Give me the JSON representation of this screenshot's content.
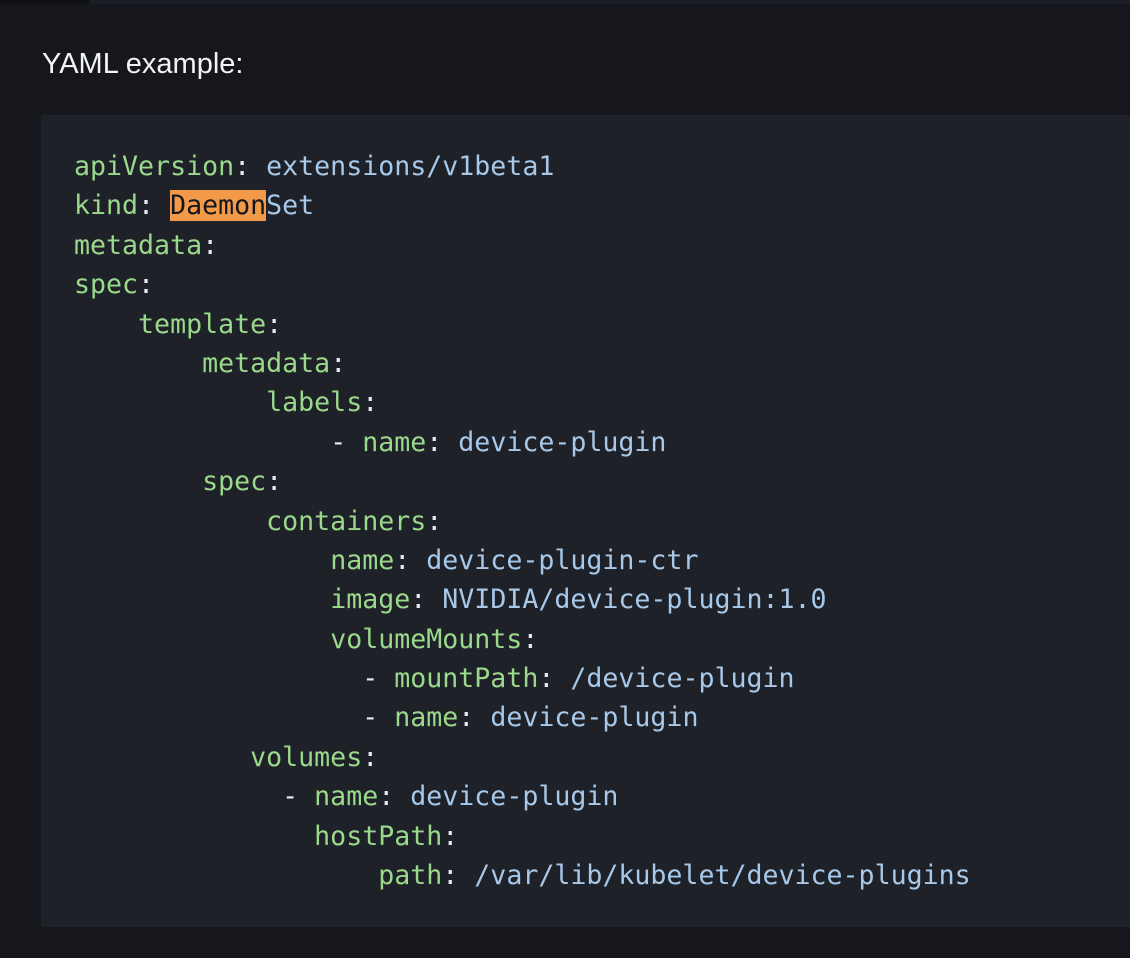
{
  "heading": "YAML example:",
  "colors": {
    "key": "#9ad88b",
    "value": "#a8c8ea",
    "punctuation": "#e6e8eb",
    "search_highlight": "#f39a4a",
    "code_background": "#1e2228",
    "page_background": "#15171c"
  },
  "code": {
    "language": "yaml",
    "lines": [
      {
        "indent": "",
        "key": "apiVersion",
        "sep": ": ",
        "value": "extensions/v1beta1"
      },
      {
        "indent": "",
        "key": "kind",
        "sep": ": ",
        "highlight": "Daemon",
        "value": "Set"
      },
      {
        "indent": "",
        "key": "metadata",
        "sep": ":"
      },
      {
        "indent": "",
        "key": "spec",
        "sep": ":"
      },
      {
        "indent": "    ",
        "key": "template",
        "sep": ":"
      },
      {
        "indent": "        ",
        "key": "metadata",
        "sep": ":"
      },
      {
        "indent": "            ",
        "key": "labels",
        "sep": ":"
      },
      {
        "indent": "                ",
        "dash": "- ",
        "key": "name",
        "sep": ": ",
        "value": "device-plugin"
      },
      {
        "indent": "        ",
        "key": "spec",
        "sep": ":"
      },
      {
        "indent": "            ",
        "key": "containers",
        "sep": ":"
      },
      {
        "indent": "                ",
        "key": "name",
        "sep": ": ",
        "value": "device-plugin-ctr"
      },
      {
        "indent": "                ",
        "key": "image",
        "sep": ": ",
        "value": "NVIDIA/device-plugin:1.0"
      },
      {
        "indent": "                ",
        "key": "volumeMounts",
        "sep": ":"
      },
      {
        "indent": "                  ",
        "dash": "- ",
        "key": "mountPath",
        "sep": ": ",
        "value": "/device-plugin"
      },
      {
        "indent": "                  ",
        "dash": "- ",
        "key": "name",
        "sep": ": ",
        "value": "device-plugin"
      },
      {
        "indent": "           ",
        "key": "volumes",
        "sep": ":"
      },
      {
        "indent": "             ",
        "dash": "- ",
        "key": "name",
        "sep": ": ",
        "value": "device-plugin"
      },
      {
        "indent": "               ",
        "key": "hostPath",
        "sep": ":"
      },
      {
        "indent": "                   ",
        "key": "path",
        "sep": ": ",
        "value": "/var/lib/kubelet/device-plugins"
      }
    ]
  }
}
